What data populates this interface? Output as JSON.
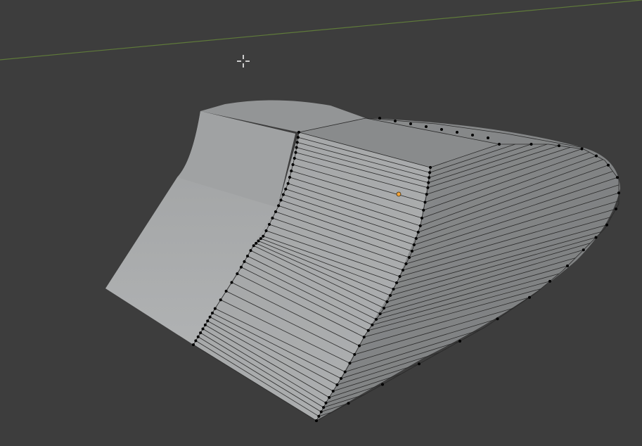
{
  "viewport": {
    "background_color": "#3d3d3d",
    "grid_axis_color": "#5f7a3a",
    "mesh_light_face_color": "#a6a8a9",
    "mesh_dark_face_color": "#838586",
    "edge_color": "#2a2a2a",
    "vertex_color": "#000000",
    "origin_color": "#f2a33a"
  },
  "icons": {
    "cursor": "3d-cursor-icon",
    "origin": "object-origin-icon"
  }
}
